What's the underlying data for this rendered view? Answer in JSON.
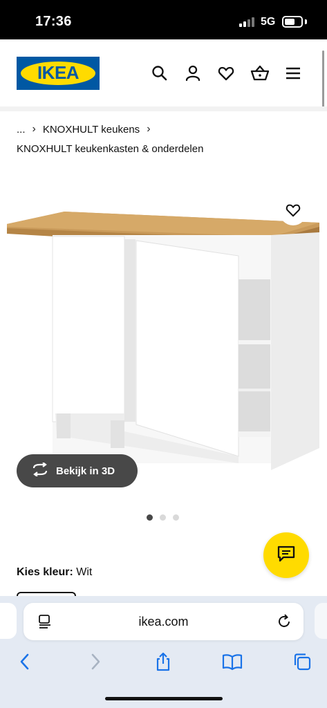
{
  "status_bar": {
    "time": "17:36",
    "network": "5G",
    "icons": [
      "signal-icon",
      "battery-icon"
    ]
  },
  "header": {
    "logo_text": "IKEA",
    "icons": [
      "search-icon",
      "account-icon",
      "heart-icon",
      "basket-icon",
      "menu-icon"
    ],
    "colors": {
      "brand_blue": "#0058a3",
      "brand_yellow": "#ffdb00"
    }
  },
  "breadcrumb": {
    "ellipsis": "...",
    "items": [
      "KNOXHULT keukens"
    ],
    "separator": "›"
  },
  "subtitle": "KNOXHULT keukenkasten & onderdelen",
  "product": {
    "favorite_icon": "heart-icon",
    "view3d_label": "Bekijk in 3D",
    "view3d_icon": "rotate-icon",
    "carousel": {
      "total": 3,
      "active": 1
    },
    "chat_icon": "chat-icon",
    "color_label": "Kies kleur:",
    "color_value": "Wit"
  },
  "browser": {
    "url": "ikea.com",
    "toolbar_icons": [
      "back-icon",
      "forward-icon",
      "share-icon",
      "bookmarks-icon",
      "tabs-icon"
    ],
    "accent": "#1a73e8"
  }
}
